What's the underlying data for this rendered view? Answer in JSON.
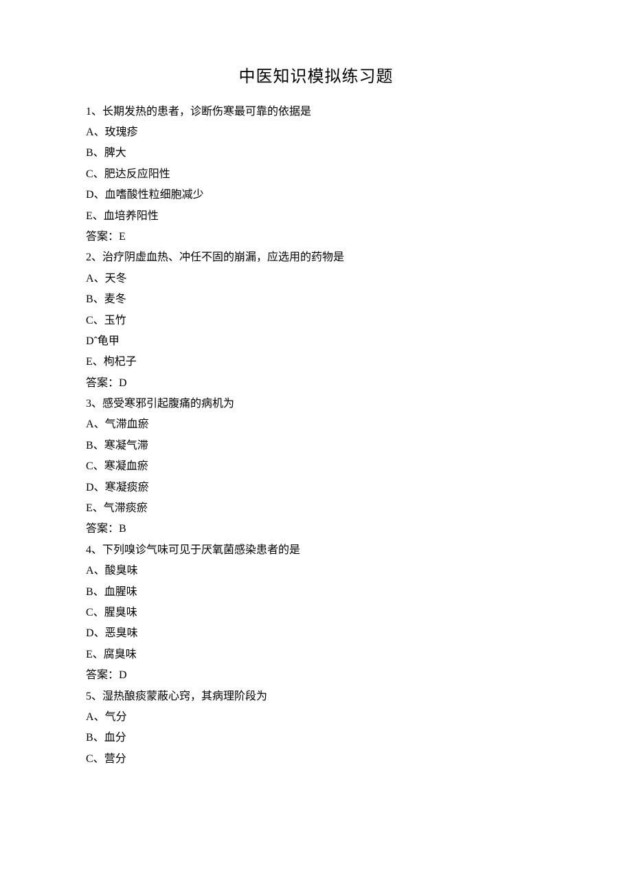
{
  "title": "中医知识模拟练习题",
  "questions": [
    {
      "num": "1",
      "stem": "长期发热的患者，诊断伤寒最可靠的依据是",
      "options": [
        {
          "letter": "A",
          "sep": "、",
          "text": "玫瑰疹"
        },
        {
          "letter": "B",
          "sep": "、",
          "text": "脾大"
        },
        {
          "letter": "C",
          "sep": "、",
          "text": "肥达反应阳性"
        },
        {
          "letter": "D",
          "sep": "、",
          "text": "血嗜酸性粒细胞减少"
        },
        {
          "letter": "E",
          "sep": "、",
          "text": "血培养阳性"
        }
      ],
      "answer_label": "答案：",
      "answer": "E"
    },
    {
      "num": "2",
      "stem": "治疗阴虚血热、冲任不固的崩漏，应选用的药物是",
      "options": [
        {
          "letter": "A",
          "sep": "、",
          "text": "天冬"
        },
        {
          "letter": "B",
          "sep": "、",
          "text": "麦冬"
        },
        {
          "letter": "C",
          "sep": "、",
          "text": "玉竹"
        },
        {
          "letter": "D",
          "sep": "ˆ",
          "text": "龟甲"
        },
        {
          "letter": "E",
          "sep": "、",
          "text": "枸杞子"
        }
      ],
      "answer_label": "答案：",
      "answer": "D"
    },
    {
      "num": "3",
      "stem": "感受寒邪引起腹痛的病机为",
      "options": [
        {
          "letter": "A",
          "sep": "、",
          "text": "气滞血瘀"
        },
        {
          "letter": "B",
          "sep": "、",
          "text": "寒凝气滞"
        },
        {
          "letter": "C",
          "sep": "、",
          "text": "寒凝血瘀"
        },
        {
          "letter": "D",
          "sep": "、",
          "text": "寒凝痰瘀"
        },
        {
          "letter": "E",
          "sep": "、",
          "text": "气滞痰瘀"
        }
      ],
      "answer_label": "答案：",
      "answer": "B"
    },
    {
      "num": "4",
      "stem": "下列嗅诊气味可见于厌氧菌感染患者的是",
      "options": [
        {
          "letter": "A",
          "sep": "、",
          "text": "酸臭味"
        },
        {
          "letter": "B",
          "sep": "、",
          "text": "血腥味"
        },
        {
          "letter": "C",
          "sep": "、",
          "text": "腥臭味"
        },
        {
          "letter": "D",
          "sep": "、",
          "text": "恶臭味"
        },
        {
          "letter": "E",
          "sep": "、",
          "text": "腐臭味"
        }
      ],
      "answer_label": "答案：",
      "answer": "D"
    },
    {
      "num": "5",
      "stem": "湿热酿痰蒙蔽心窍，其病理阶段为",
      "options": [
        {
          "letter": "A",
          "sep": "、",
          "text": "气分"
        },
        {
          "letter": "B",
          "sep": "、",
          "text": "血分"
        },
        {
          "letter": "C",
          "sep": "、",
          "text": "营分"
        }
      ],
      "answer_label": "",
      "answer": ""
    }
  ]
}
